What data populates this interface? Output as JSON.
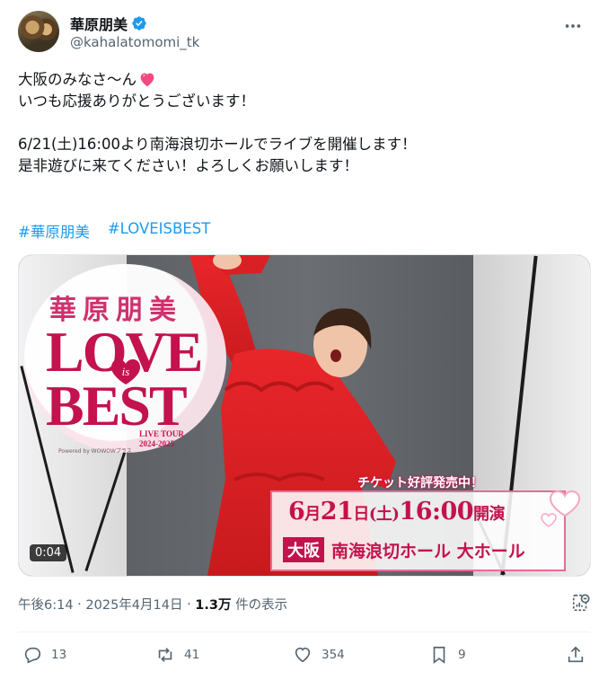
{
  "author": {
    "display_name": "華原朋美",
    "handle": "@kahalatomomi_tk",
    "verified": true
  },
  "tweet": {
    "line1": "大阪のみなさ〜ん",
    "line2": "いつも応援ありがとうございます！",
    "line3": "6/21(土)16:00より南海浪切ホールでライブを開催します！",
    "line4": "是非遊びに来てください！よろしくお願いします！",
    "hashtags": [
      "#華原朋美",
      "#LOVEISBEST"
    ]
  },
  "media": {
    "logo_kanji": "華原朋美",
    "logo_love": "LOVE",
    "logo_is": "is",
    "logo_best": "BEST",
    "logo_tour_1": "LIVE TOUR",
    "logo_tour_2": "2024-2025",
    "logo_sponsor": "Powered by WOWOWプラス",
    "ticket_text": "チケット好評発売中！",
    "date_month": "6",
    "date_month_unit": "月",
    "date_day": "21",
    "date_day_unit": "日",
    "date_weekday": "(土)",
    "date_time": "16:00",
    "date_suffix": "開演",
    "venue_city": "大阪",
    "venue_name": "南海浪切ホール 大ホール",
    "video_time": "0:04"
  },
  "meta": {
    "time": "午後6:14",
    "separator": " · ",
    "date": "2025年4月14日",
    "views_count": "1.3万",
    "views_label": " 件の表示"
  },
  "actions": {
    "replies": "13",
    "reposts": "41",
    "likes": "354",
    "bookmarks": "9"
  },
  "colors": {
    "accent": "#1d9bf0",
    "brand_pink": "#c3124d",
    "text_secondary": "#536471"
  }
}
